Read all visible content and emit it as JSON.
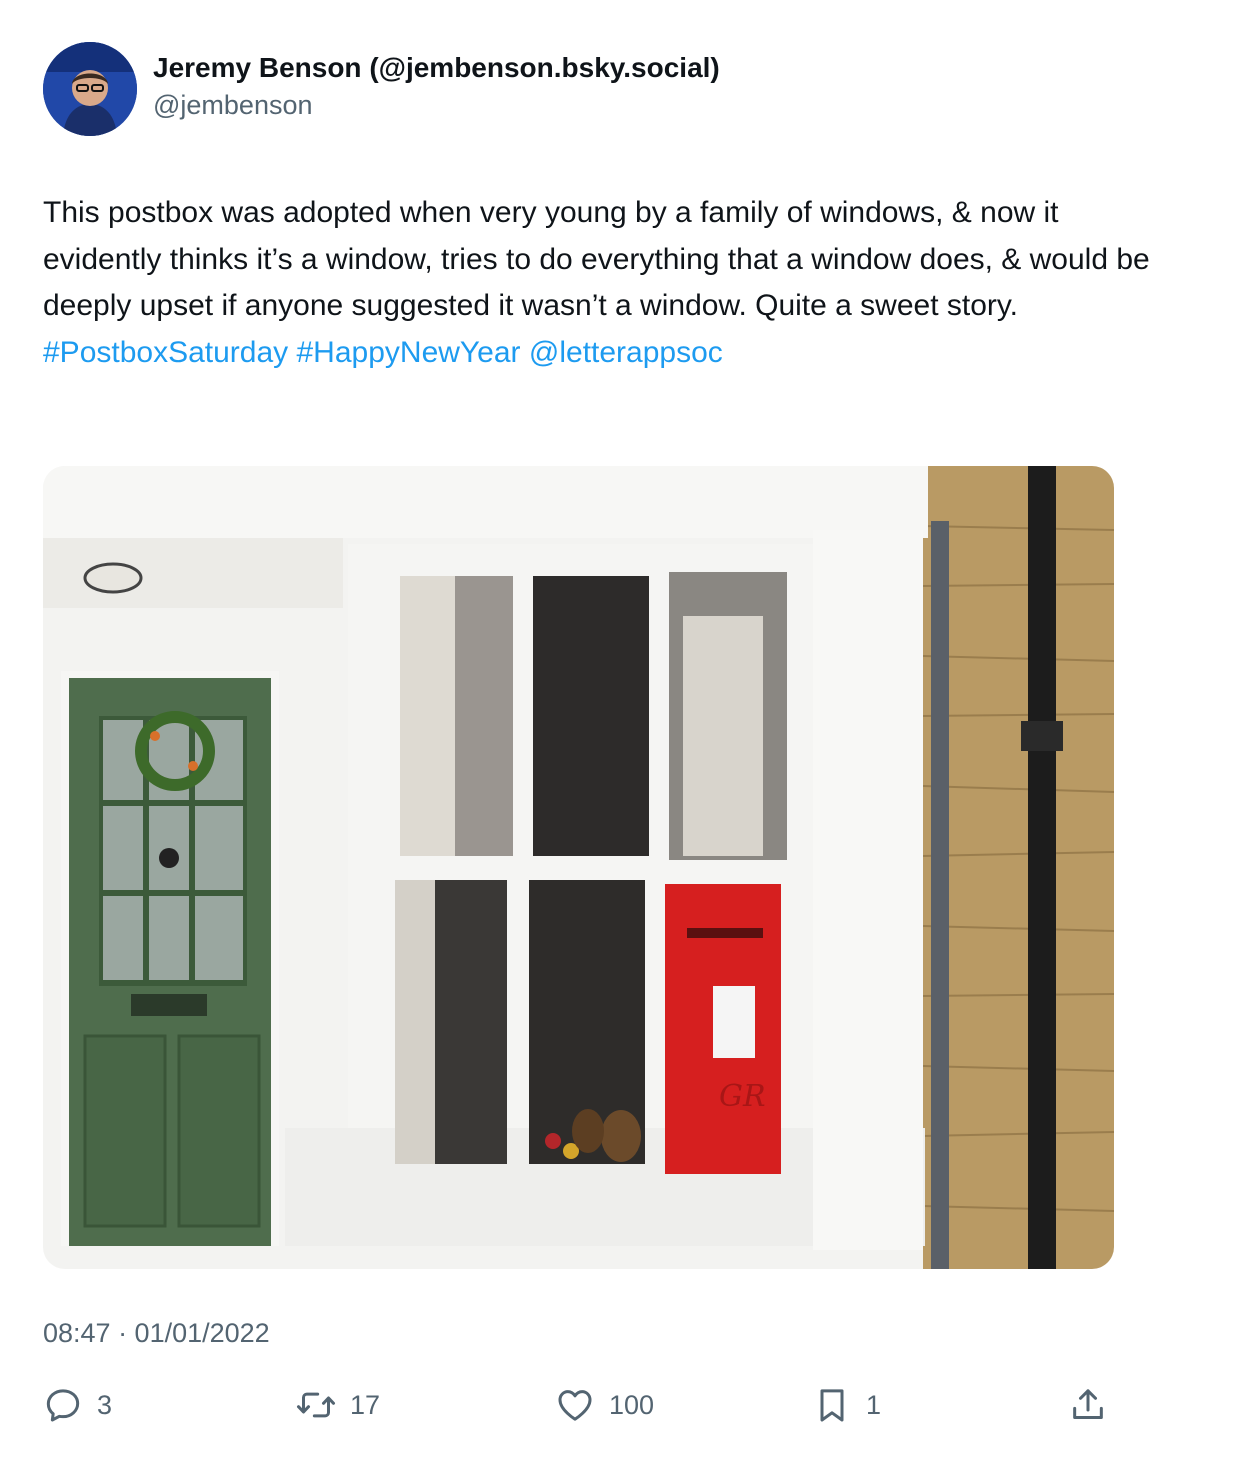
{
  "author": {
    "display_name": "Jeremy Benson (@jembenson.bsky.social)",
    "handle": "@jembenson"
  },
  "tweet": {
    "text": "This postbox was adopted when very young by a family of windows, & now it evidently thinks it’s a window, tries to do everything that a window does, & would be deeply upset if anyone suggested it wasn’t a window. Quite a sweet story.",
    "hashtags": [
      "#PostboxSaturday",
      "#HappyNewYear",
      "@letterappsoc"
    ],
    "timestamp": "08:47 · 01/01/2022"
  },
  "actions": {
    "replies": "3",
    "reposts": "17",
    "likes": "100",
    "bookmarks": "1"
  },
  "colors": {
    "link": "#1d9bf0",
    "text": "#0f1419",
    "muted": "#536471"
  }
}
